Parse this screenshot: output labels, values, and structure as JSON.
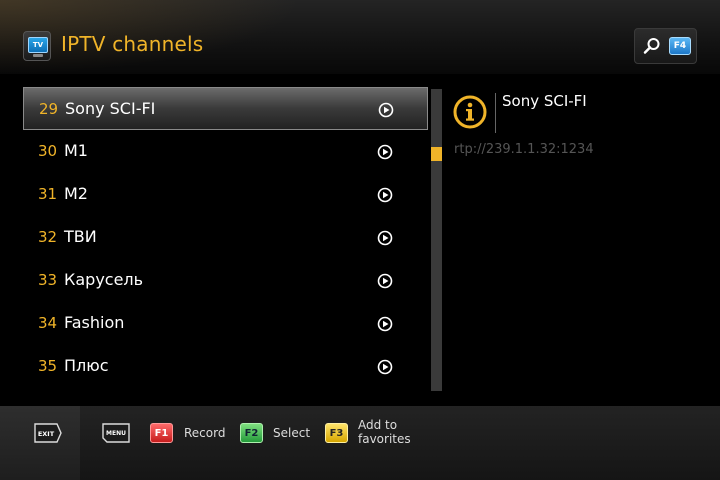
{
  "header": {
    "tv_icon_label": "TV",
    "title": "IPTV channels",
    "search_key": "F4"
  },
  "channels": [
    {
      "number": "29",
      "name": "Sony SCI-FI",
      "selected": true
    },
    {
      "number": "30",
      "name": "M1",
      "selected": false
    },
    {
      "number": "31",
      "name": "M2",
      "selected": false
    },
    {
      "number": "32",
      "name": "ТВИ",
      "selected": false
    },
    {
      "number": "33",
      "name": "Карусель",
      "selected": false
    },
    {
      "number": "34",
      "name": "Fashion",
      "selected": false
    },
    {
      "number": "35",
      "name": "Плюс",
      "selected": false
    }
  ],
  "info": {
    "name": "Sony SCI-FI",
    "url": "rtp://239.1.1.32:1234"
  },
  "footer": {
    "exit_label": "EXIT",
    "menu_label": "MENU",
    "f1_key": "F1",
    "f1_label": "Record",
    "f2_key": "F2",
    "f2_label": "Select",
    "f3_key": "F3",
    "f3_label": "Add to favorites"
  },
  "colors": {
    "accent": "#f0b429",
    "f1": "#c61d1d",
    "f2": "#249b3b",
    "f3": "#d6a600",
    "f4": "#1d78c9"
  }
}
